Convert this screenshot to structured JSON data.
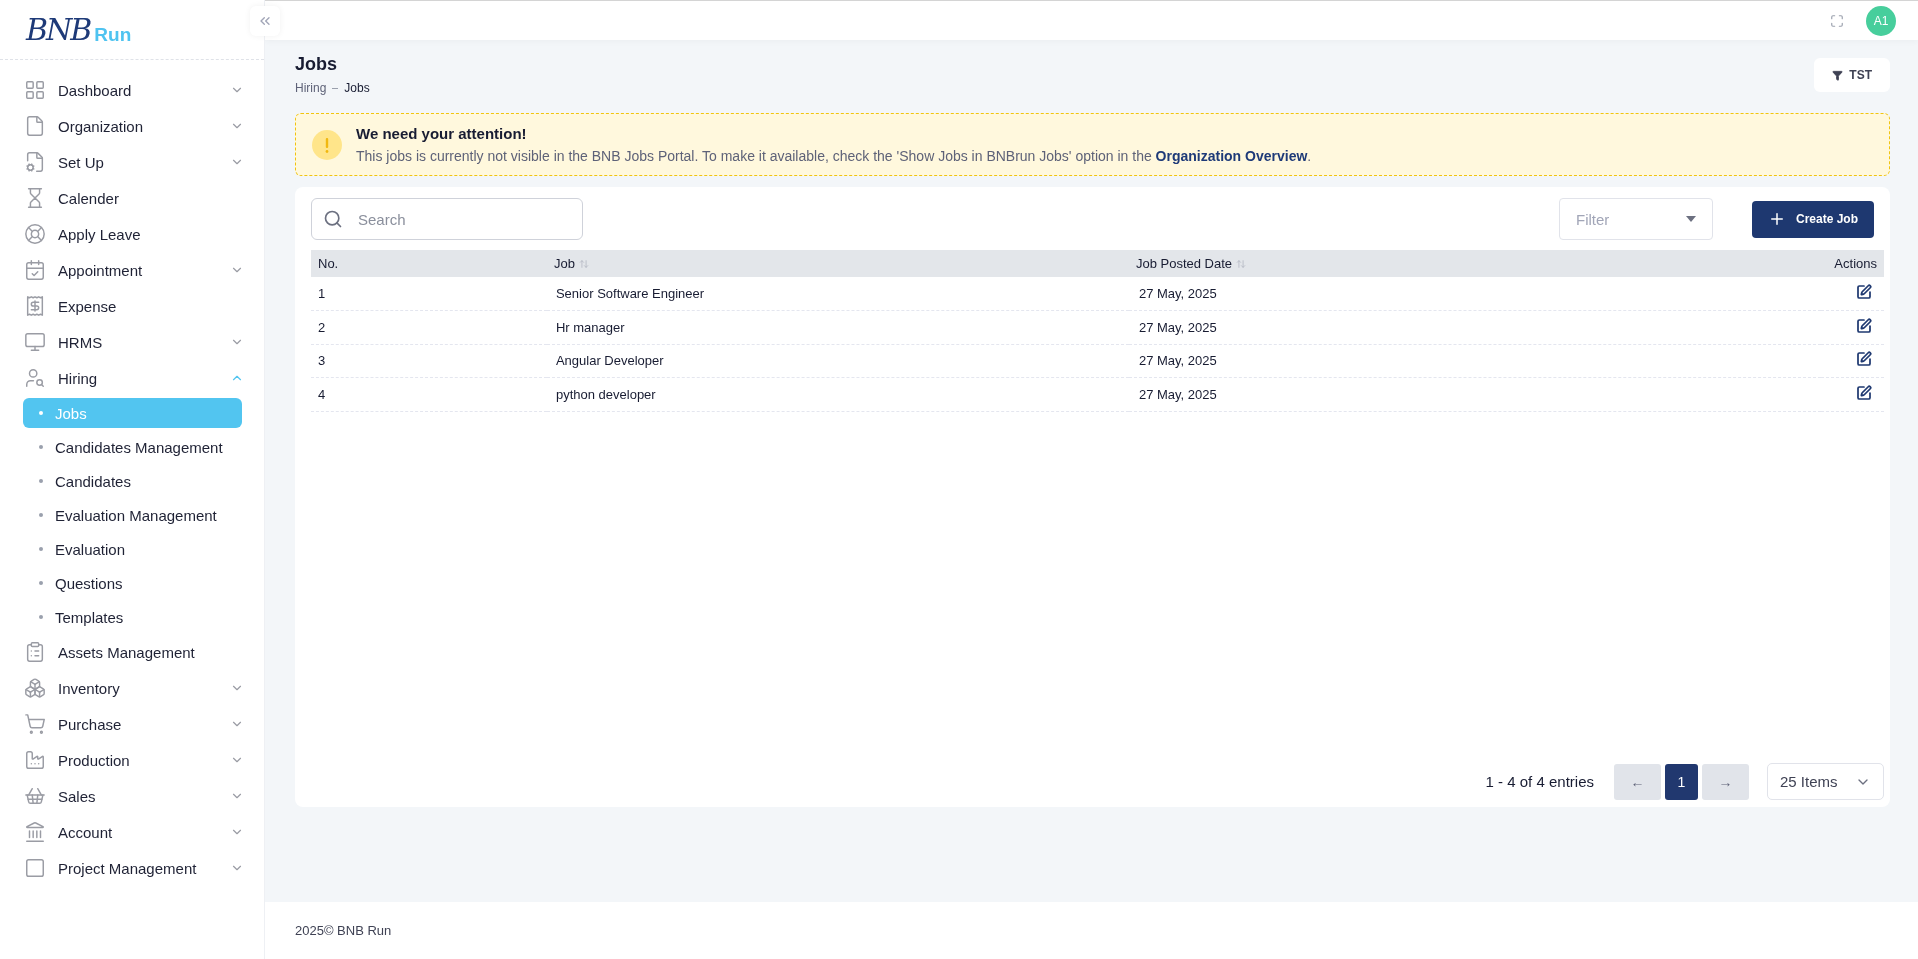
{
  "logo": {
    "mark": "BNB",
    "word": "Run"
  },
  "topbar": {
    "avatar": "A1"
  },
  "sidebar": {
    "items": [
      {
        "label": "Dashboard",
        "expanded": false
      },
      {
        "label": "Organization",
        "expanded": false
      },
      {
        "label": "Set Up",
        "expanded": false
      },
      {
        "label": "Calender"
      },
      {
        "label": "Apply Leave"
      },
      {
        "label": "Appointment",
        "expanded": false
      },
      {
        "label": "Expense"
      },
      {
        "label": "HRMS",
        "expanded": false
      },
      {
        "label": "Hiring",
        "expanded": true,
        "children": [
          {
            "label": "Jobs",
            "selected": true
          },
          {
            "label": "Candidates Management",
            "selected": false
          },
          {
            "label": "Candidates",
            "selected": false
          },
          {
            "label": "Evaluation Management",
            "selected": false
          },
          {
            "label": "Evaluation",
            "selected": false
          },
          {
            "label": "Questions",
            "selected": false
          },
          {
            "label": "Templates",
            "selected": false
          }
        ]
      },
      {
        "label": "Assets Management"
      },
      {
        "label": "Inventory",
        "expanded": false
      },
      {
        "label": "Purchase",
        "expanded": false
      },
      {
        "label": "Production",
        "expanded": false
      },
      {
        "label": "Sales",
        "expanded": false
      },
      {
        "label": "Account",
        "expanded": false
      },
      {
        "label": "Project Management",
        "expanded": false
      }
    ]
  },
  "page": {
    "title": "Jobs",
    "breadcrumb": [
      "Hiring",
      "Jobs"
    ],
    "filter_button": "TST"
  },
  "alert": {
    "title": "We need your attention!",
    "text": "This jobs is currently not visible in the BNB Jobs Portal. To make it available, check the 'Show Jobs in BNBrun Jobs' option in the",
    "link": "Organization Overview",
    "end": "."
  },
  "toolbar": {
    "search": {
      "placeholder": "Search"
    },
    "filter": {
      "placeholder": "Filter"
    },
    "create_button": "Create Job"
  },
  "table": {
    "columns": [
      {
        "label": "No.",
        "sortable": false
      },
      {
        "label": "Job",
        "sortable": true
      },
      {
        "label": "Job Posted Date",
        "sortable": true
      },
      {
        "label": "Actions",
        "sortable": false
      }
    ],
    "rows": [
      {
        "no": "1",
        "job": "Senior Software Engineer",
        "date": "27 May, 2025"
      },
      {
        "no": "2",
        "job": "Hr manager",
        "date": "27 May, 2025"
      },
      {
        "no": "3",
        "job": "Angular Developer",
        "date": "27 May, 2025"
      },
      {
        "no": "4",
        "job": "python developer",
        "date": "27 May, 2025"
      }
    ]
  },
  "pagination": {
    "summary": "1 - 4 of 4 entries",
    "prev": "←",
    "pages": [
      {
        "label": "1",
        "selected": true
      }
    ],
    "next": "→",
    "page_size": "25 Items"
  },
  "footer": {
    "text": "2025© BNB Run"
  }
}
